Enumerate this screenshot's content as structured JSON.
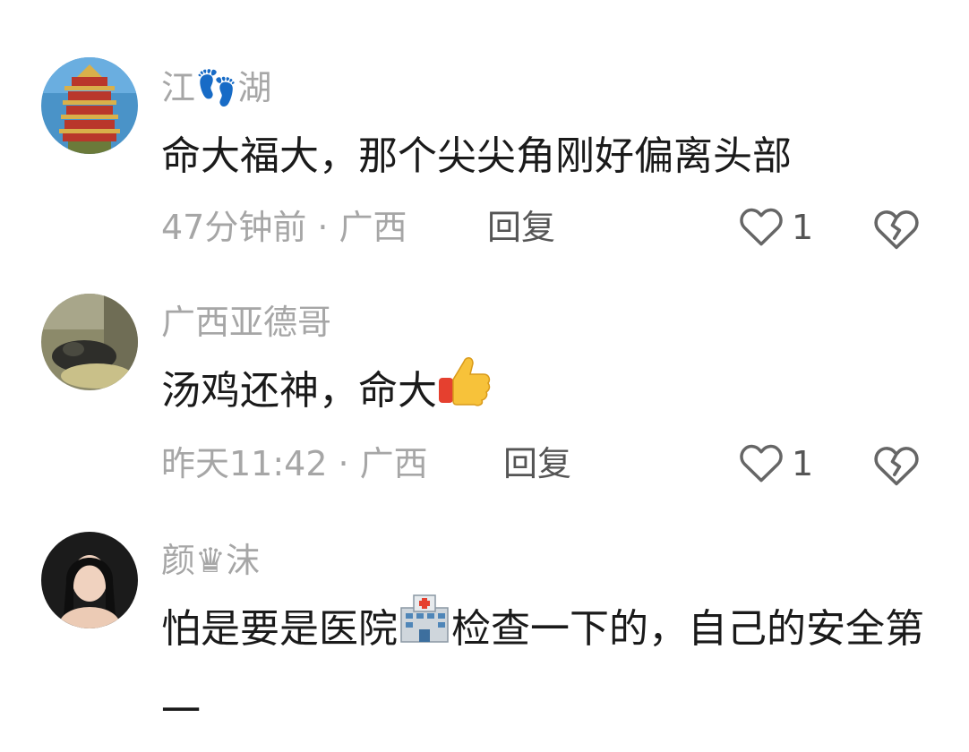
{
  "comments": [
    {
      "username": "江👣湖",
      "text": "命大福大，那个尖尖角刚好偏离头部",
      "time": "47分钟前",
      "location": "广西",
      "reply_label": "回复",
      "likes": "1"
    },
    {
      "username": "广西亚德哥",
      "text": "汤鸡还神，命大",
      "time": "昨天11:42",
      "location": "广西",
      "reply_label": "回复",
      "likes": "1"
    },
    {
      "username": "颜♛沫",
      "text_part1": "怕是要是医院",
      "text_part2": "检查一下的，自己的安全第一"
    }
  ],
  "separator": "·",
  "icons": {
    "like": "heart-outline-icon",
    "dislike": "broken-heart-icon",
    "thumbs_up": "thumbs-up-emoji-icon",
    "hospital": "hospital-emoji-icon"
  }
}
